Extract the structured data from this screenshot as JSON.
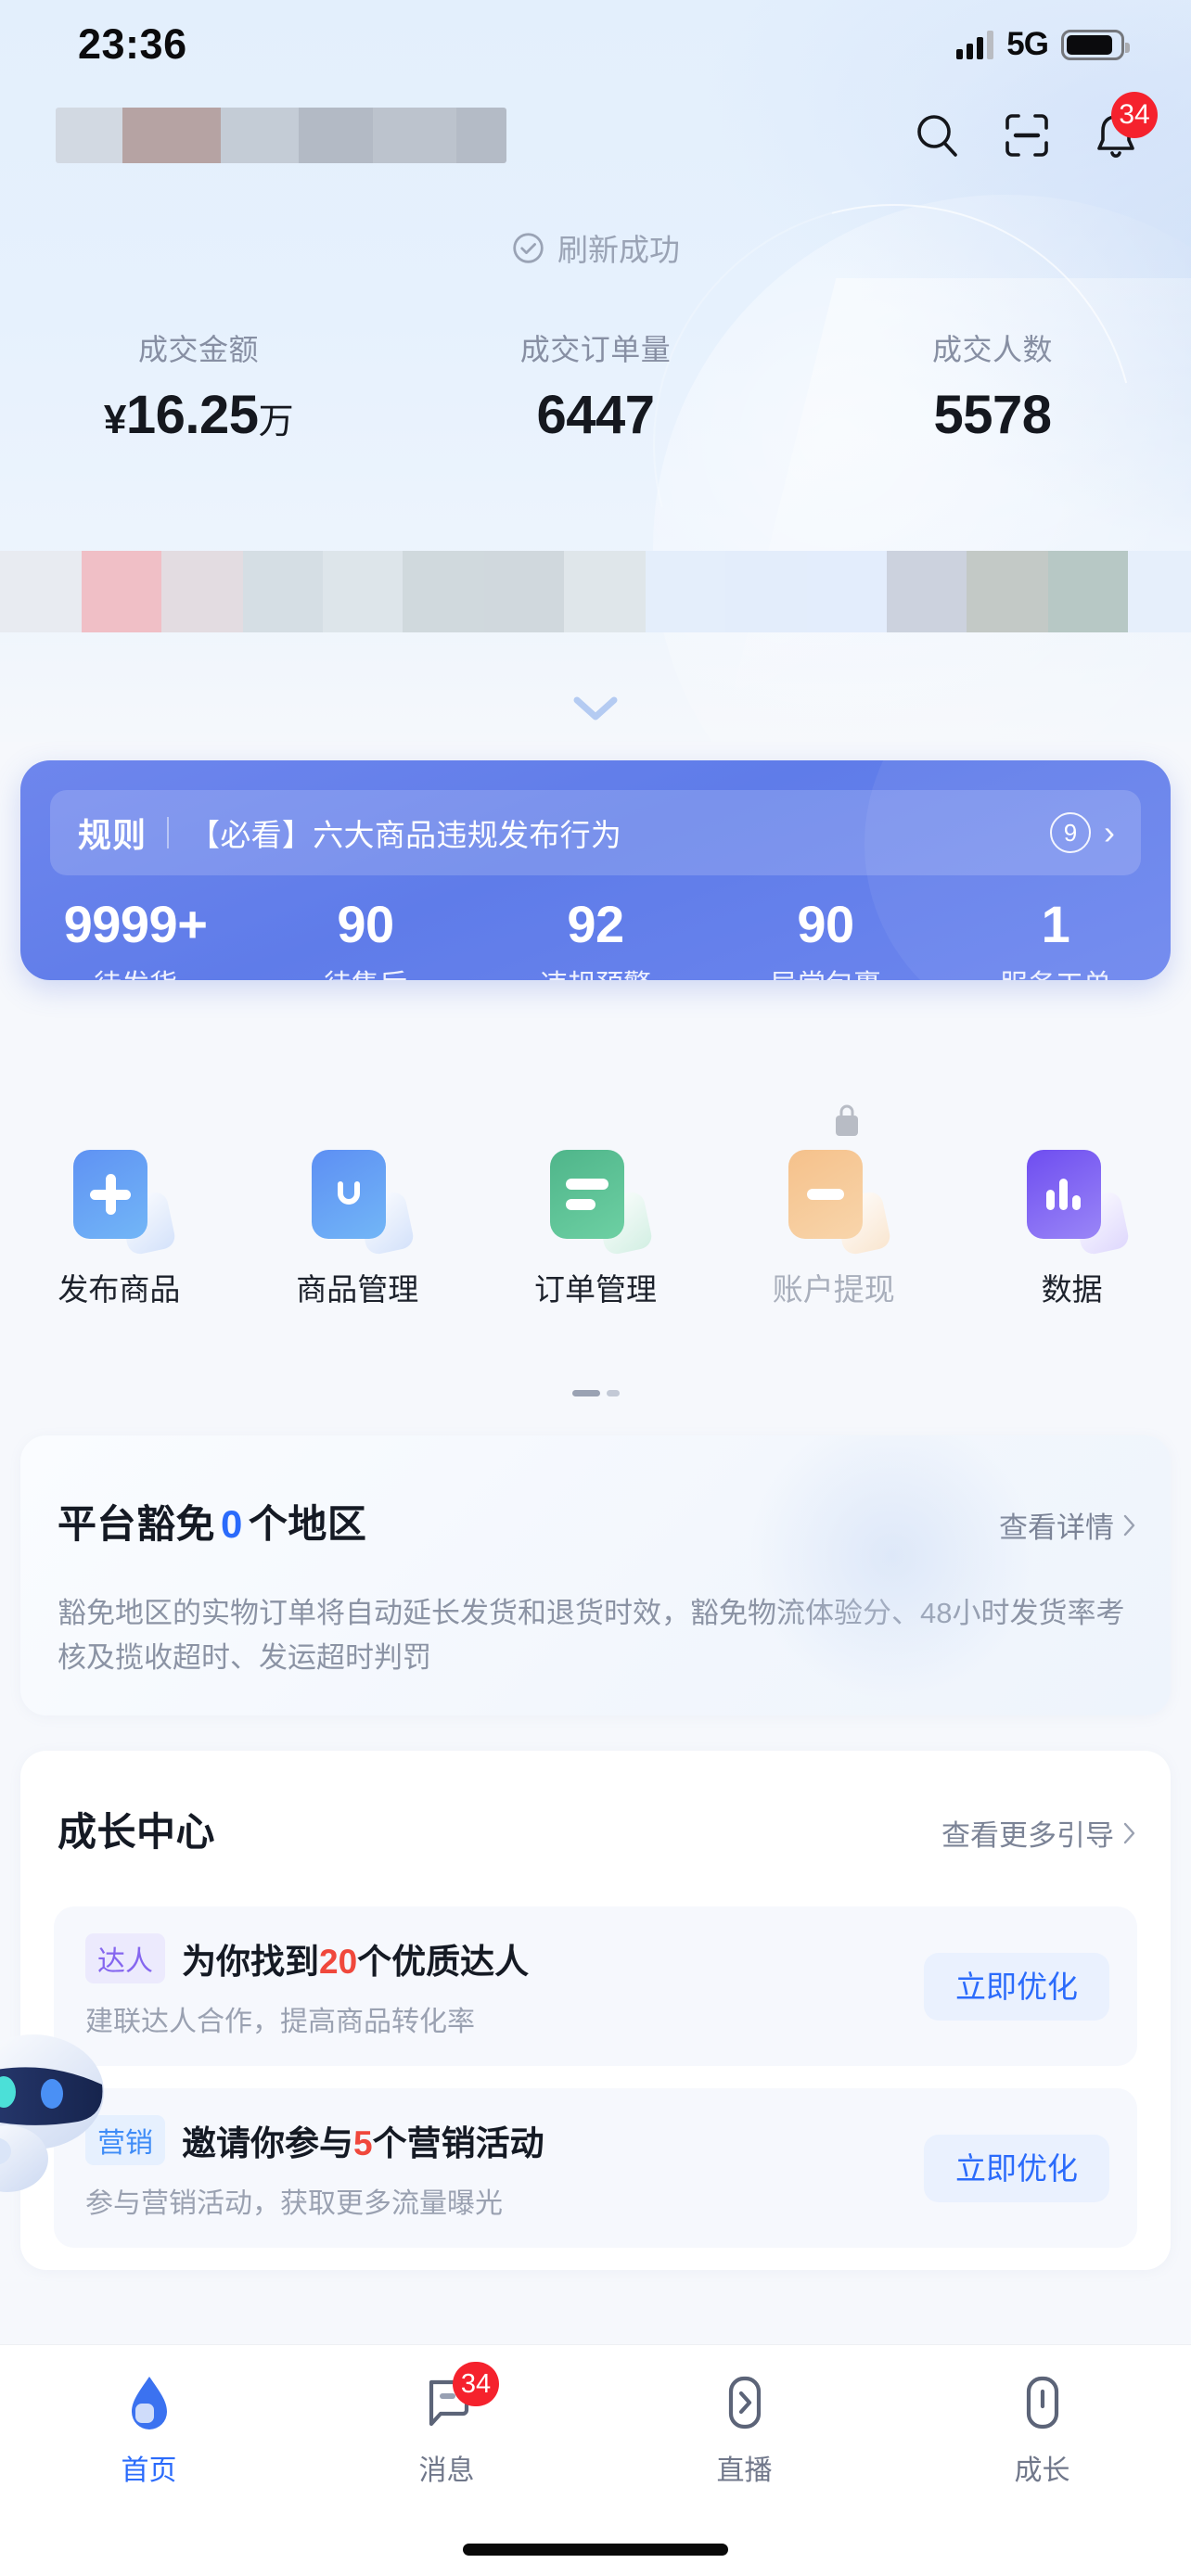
{
  "status_bar": {
    "time": "23:36",
    "network": "5G",
    "signal_icon": "signal-bars-icon",
    "battery_icon": "battery-icon"
  },
  "header": {
    "shop_name_redacted": "",
    "icons": [
      {
        "name": "search-icon",
        "label": "搜索"
      },
      {
        "name": "scan-icon",
        "label": "扫一扫"
      },
      {
        "name": "bell-icon",
        "label": "通知",
        "badge": "34"
      }
    ]
  },
  "refresh_toast": {
    "icon": "check-circle-icon",
    "text": "刷新成功"
  },
  "stats": [
    {
      "label": "成交金额",
      "value": "16.25",
      "currency": "¥",
      "unit": "万"
    },
    {
      "label": "成交订单量",
      "value": "6447",
      "currency": "",
      "unit": ""
    },
    {
      "label": "成交人数",
      "value": "5578",
      "currency": "",
      "unit": ""
    }
  ],
  "expand_icon": "chevron-down-icon",
  "rules_card": {
    "tag": "规则",
    "headline": "【必看】六大商品违规发布行为",
    "count": "9",
    "arrow_icon": "chevron-right-icon",
    "accent": "#6178e9",
    "kpis": [
      {
        "value": "9999+",
        "label": "待发货"
      },
      {
        "value": "90",
        "label": "待售后"
      },
      {
        "value": "92",
        "label": "违规预警"
      },
      {
        "value": "90",
        "label": "异常包裹"
      },
      {
        "value": "1",
        "label": "服务工单"
      }
    ]
  },
  "quick_actions": [
    {
      "label": "发布商品",
      "icon": "plus-square-icon",
      "color": "#4b8ef5",
      "disabled": false
    },
    {
      "label": "商品管理",
      "icon": "shopping-bag-icon",
      "color": "#4b8ef5",
      "disabled": false
    },
    {
      "label": "订单管理",
      "icon": "order-list-icon",
      "color": "#4fba8a",
      "disabled": false
    },
    {
      "label": "账户提现",
      "icon": "withdraw-icon",
      "color": "#f2b279",
      "disabled": true,
      "lock_icon": "lock-icon"
    },
    {
      "label": "数据",
      "icon": "bar-chart-icon",
      "color": "#7a5bf0",
      "disabled": false
    }
  ],
  "pagination": {
    "active_index": 0,
    "count": 2
  },
  "exemption": {
    "title_prefix": "平台豁免",
    "count": "0",
    "title_suffix": "个地区",
    "more_label": "查看详情",
    "more_icon": "chevron-right-icon",
    "description": "豁免地区的实物订单将自动延长发货和退货时效，豁免物流体验分、48小时发货率考核及揽收超时、发运超时判罚"
  },
  "growth_center": {
    "title": "成长中心",
    "more_label": "查看更多引导",
    "more_icon": "chevron-right-icon",
    "items": [
      {
        "tag": "达人",
        "tag_style": "daren",
        "headline_before": "为你找到",
        "headline_number": "20",
        "headline_after": "个优质达人",
        "subtitle": "建联达人合作，提高商品转化率",
        "button": "立即优化"
      },
      {
        "tag": "营销",
        "tag_style": "yx",
        "headline_before": "邀请你参与",
        "headline_number": "5",
        "headline_after": "个营销活动",
        "subtitle": "参与营销活动，获取更多流量曝光",
        "button": "立即优化"
      }
    ]
  },
  "mascot": {
    "icon": "robot-assistant-icon"
  },
  "tabbar": [
    {
      "label": "首页",
      "icon": "home-icon",
      "active": true,
      "badge": ""
    },
    {
      "label": "消息",
      "icon": "message-icon",
      "active": false,
      "badge": "34"
    },
    {
      "label": "直播",
      "icon": "live-icon",
      "active": false,
      "badge": ""
    },
    {
      "label": "成长",
      "icon": "growth-icon",
      "active": false,
      "badge": ""
    }
  ],
  "colors": {
    "accent_blue": "#2b6bfb",
    "card_blue": "#6178e9",
    "badge_red": "#f5222d",
    "number_red": "#f0483c"
  }
}
